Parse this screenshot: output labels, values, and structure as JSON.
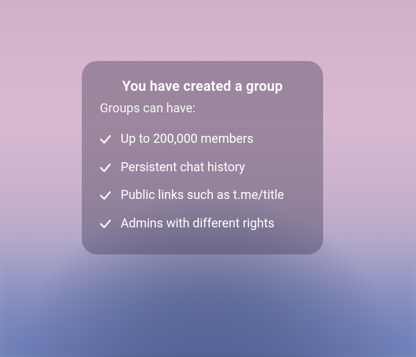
{
  "card": {
    "title": "You have created a group",
    "subtitle": "Groups can have:",
    "features": [
      "Up to 200,000 members",
      "Persistent chat history",
      "Public links such as t.me/title",
      "Admins with different rights"
    ]
  }
}
